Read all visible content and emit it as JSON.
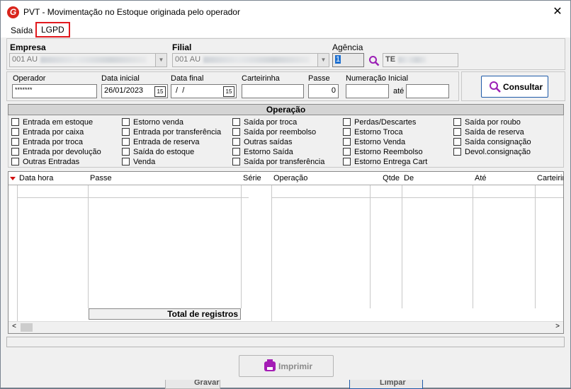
{
  "window": {
    "title": "PVT - Movimentação no Estoque originada pelo operador",
    "app_icon": "G"
  },
  "menu": {
    "items": [
      "Saída",
      "LGPD"
    ]
  },
  "filters": {
    "empresa_label": "Empresa",
    "empresa_value": "001 AU",
    "filial_label": "Filial",
    "filial_value": "001 AU",
    "agencia_label": "Agência",
    "agencia_value": "1",
    "agencia_name": "TE",
    "operador_label": "Operador",
    "operador_value": "*******",
    "data_inicial_label": "Data inicial",
    "data_inicial_value": "26/01/2023",
    "data_final_label": "Data final",
    "data_final_value": " /  / ",
    "carteirinha_label": "Carteirinha",
    "passe_label": "Passe",
    "passe_value": "0",
    "numeracao_label": "Numeração Inicial",
    "ate_label": "até",
    "calendar_glyph": "15",
    "consultar_label": "Consultar"
  },
  "operacao": {
    "header": "Operação",
    "columns": [
      [
        "Entrada em estoque",
        "Entrada por caixa",
        "Entrada por troca",
        "Entrada por devolução",
        "Outras Entradas"
      ],
      [
        "Estorno venda",
        "Entrada por transferência",
        "Entrada de reserva",
        "Saída do estoque",
        "Venda"
      ],
      [
        "Saída por troca",
        "Saída por reembolso",
        "Outras saídas",
        "Estorno Saída",
        "Saída por transferência"
      ],
      [
        "Perdas/Descartes",
        "Estorno Troca",
        "Estorno Venda",
        "Estorno Reembolso",
        "Estorno Entrega Cart"
      ],
      [
        "Saída por roubo",
        "Saída de reserva",
        "Saída consignação",
        "Devol.consignação"
      ]
    ]
  },
  "grid": {
    "columns": [
      "Data hora",
      "Passe",
      "Série",
      "Operação",
      "Qtde",
      "De",
      "Até",
      "Carteirin"
    ],
    "total_label": "Total de registros"
  },
  "footer": {
    "imprimir_label": "Imprimir",
    "behind_left": "Gravar",
    "behind_right": "Limpar"
  },
  "colors": {
    "accent": "#1e5aa8",
    "lgpd_highlight": "#e1191e",
    "print_icon": "#a41db5"
  }
}
